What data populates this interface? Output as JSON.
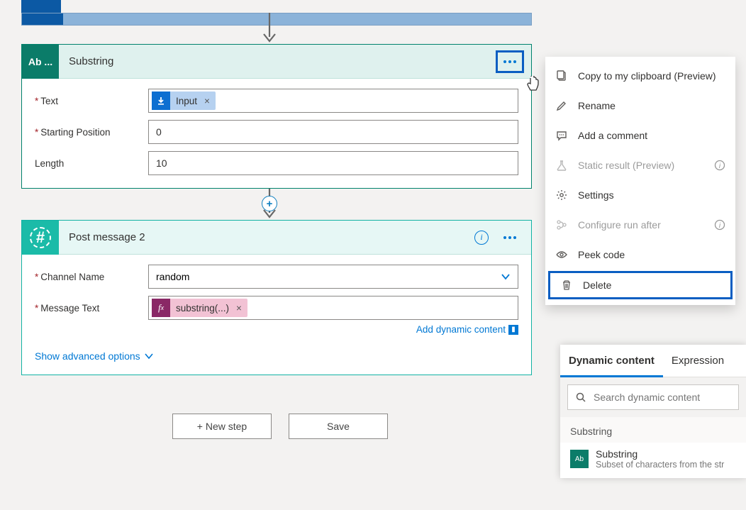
{
  "canvas": {
    "card1": {
      "icon_label": "Ab ...",
      "title": "Substring",
      "fields": {
        "text_label": "Text",
        "text_token": "Input",
        "start_label": "Starting Position",
        "start_value": "0",
        "length_label": "Length",
        "length_value": "10"
      }
    },
    "card2": {
      "title": "Post message 2",
      "fields": {
        "channel_label": "Channel Name",
        "channel_value": "random",
        "msg_label": "Message Text",
        "msg_token": "substring(...)"
      },
      "dyn_link": "Add dynamic content",
      "adv_link": "Show advanced options"
    },
    "buttons": {
      "new_step": "+ New step",
      "save": "Save"
    }
  },
  "ctx_menu": {
    "copy": "Copy to my clipboard (Preview)",
    "rename": "Rename",
    "comment": "Add a comment",
    "static": "Static result (Preview)",
    "settings": "Settings",
    "configure": "Configure run after",
    "peek": "Peek code",
    "delete": "Delete"
  },
  "dyn_panel": {
    "tab1": "Dynamic content",
    "tab2": "Expression",
    "search_placeholder": "Search dynamic content",
    "category": "Substring",
    "result_title": "Substring",
    "result_sub": "Subset of characters from the str",
    "result_icon": "Ab"
  }
}
